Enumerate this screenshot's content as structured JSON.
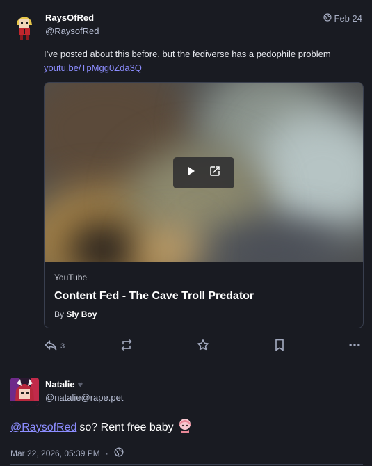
{
  "post1": {
    "display_name": "RaysOfRed",
    "handle": "@RaysofRed",
    "date": "Feb 24",
    "visibility_icon": "globe-icon",
    "text": "I’ve posted about this before, but the fediverse has a pedophile problem",
    "link_text": "youtu.be/TpMgg0Zda3Q",
    "card": {
      "provider": "YouTube",
      "title": "Content Fed - The Cave Troll Predator",
      "author_prefix": "By",
      "author_name": "Sly Boy"
    },
    "actions": {
      "reply_count": "3",
      "icons": [
        "reply-icon",
        "boost-icon",
        "favourite-icon",
        "bookmark-icon",
        "more-icon"
      ]
    }
  },
  "post2": {
    "display_name": "Natalie",
    "handle": "@natalie@rape.pet",
    "mention": "@RaysofRed",
    "text": "so? Rent free baby",
    "timestamp": "Mar 22, 2026, 05:39 PM",
    "separator": "·",
    "visibility_icon": "globe-icon"
  },
  "colors": {
    "background": "#191b22",
    "link": "#8c8dff",
    "muted": "#a6adc2",
    "border": "#393f4f"
  }
}
